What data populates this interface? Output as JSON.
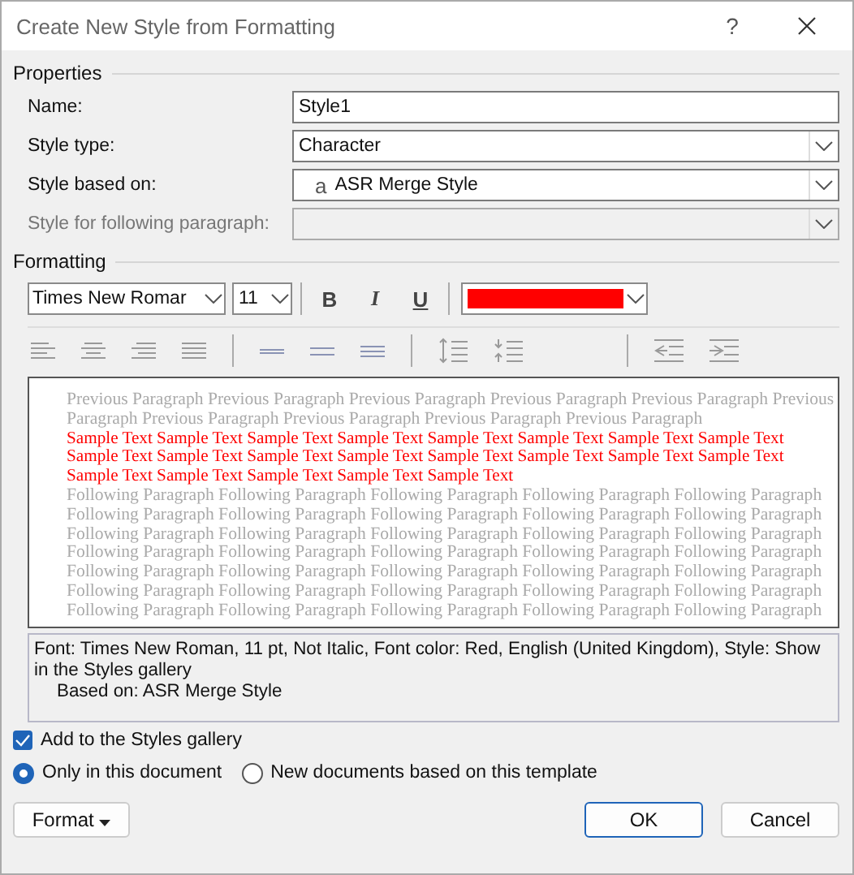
{
  "window": {
    "title": "Create New Style from Formatting",
    "help": "?"
  },
  "properties": {
    "heading": "Properties",
    "fields": [
      {
        "label": "Name:",
        "kind": "text",
        "value": "Style1",
        "disabled": false
      },
      {
        "label": "Style type:",
        "kind": "dropdown",
        "value": "Character",
        "disabled": false
      },
      {
        "label": "Style based on:",
        "kind": "dropdown",
        "glyph": "a",
        "value": "ASR Merge Style",
        "disabled": false
      },
      {
        "label": "Style for following paragraph:",
        "kind": "dropdown",
        "disabled": true
      }
    ]
  },
  "formatting": {
    "heading": "Formatting",
    "font": "Times New Romar",
    "size": "11",
    "bold": "B",
    "italic": "I",
    "underline": "U",
    "color": "#ff0000"
  },
  "preview": {
    "lines": [
      {
        "kind": "previous",
        "text": "Previous Paragraph Previous Paragraph Previous Paragraph Previous Paragraph Previous Paragraph Previous"
      },
      {
        "kind": "previous",
        "text": "Paragraph Previous Paragraph Previous Paragraph Previous Paragraph Previous Paragraph"
      },
      {
        "kind": "sample",
        "text": "Sample Text Sample Text Sample Text Sample Text Sample Text Sample Text Sample Text Sample Text"
      },
      {
        "kind": "sample",
        "text": "Sample Text Sample Text Sample Text Sample Text Sample Text Sample Text Sample Text Sample Text"
      },
      {
        "kind": "sample",
        "text": "Sample Text Sample Text Sample Text Sample Text Sample Text"
      },
      {
        "kind": "following",
        "text": "Following Paragraph Following Paragraph Following Paragraph Following Paragraph Following Paragraph"
      },
      {
        "kind": "following",
        "text": "Following Paragraph Following Paragraph Following Paragraph Following Paragraph Following Paragraph"
      },
      {
        "kind": "following",
        "text": "Following Paragraph Following Paragraph Following Paragraph Following Paragraph Following Paragraph"
      },
      {
        "kind": "following",
        "text": "Following Paragraph Following Paragraph Following Paragraph Following Paragraph Following Paragraph"
      },
      {
        "kind": "following",
        "text": "Following Paragraph Following Paragraph Following Paragraph Following Paragraph Following Paragraph"
      },
      {
        "kind": "following",
        "text": "Following Paragraph Following Paragraph Following Paragraph Following Paragraph Following Paragraph"
      },
      {
        "kind": "following",
        "text": "Following Paragraph Following Paragraph Following Paragraph Following Paragraph Following Paragraph"
      }
    ]
  },
  "description": {
    "text": "Font: Times New Roman, 11 pt, Not Italic, Font color: Red, English (United Kingdom), Style: Show in the Styles gallery",
    "based_on": "Based on: ASR Merge Style"
  },
  "options": {
    "add_to_gallery": {
      "label": "Add to the Styles gallery",
      "checked": true
    },
    "scope": [
      {
        "label": "Only in this document",
        "selected": true
      },
      {
        "label": "New documents based on this template",
        "selected": false
      }
    ]
  },
  "buttons": {
    "format": "Format",
    "ok": "OK",
    "cancel": "Cancel"
  }
}
